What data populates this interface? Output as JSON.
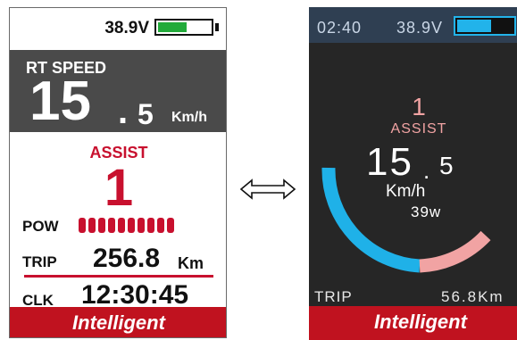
{
  "left_display": {
    "voltage": "38.9V",
    "battery_level": 0.55,
    "speed_label": "RT SPEED",
    "speed_int": "15",
    "speed_dot": ".",
    "speed_dec": "5",
    "speed_unit": "Km/h",
    "assist_label": "ASSIST",
    "assist_level": "1",
    "pow_label": "POW",
    "pow_segments": 10,
    "trip_label": "TRIP",
    "trip_value": "256.8",
    "trip_unit": "Km",
    "clk_label": "CLK",
    "clock": "12:30:45",
    "brand": "Intelligent"
  },
  "swap_arrow_icon": "double-arrow-icon",
  "right_display": {
    "clock": "02:40",
    "voltage": "38.9V",
    "battery_level": 0.62,
    "assist_level": "1",
    "assist_label": "ASSIST",
    "speed_int": "15",
    "speed_dot": ".",
    "speed_dec": "5",
    "speed_unit": "Km/h",
    "power": "39w",
    "trip_label": "TRIP",
    "trip_value": "56.8Km",
    "brand": "Intelligent"
  },
  "colors": {
    "accent_red": "#c8102e",
    "battery_green": "#22aa3a",
    "arc_blue": "#1fb1e8",
    "arc_pink": "#f1a3a3",
    "status_bar": "#2f3f52",
    "dark_bg": "#262626"
  }
}
